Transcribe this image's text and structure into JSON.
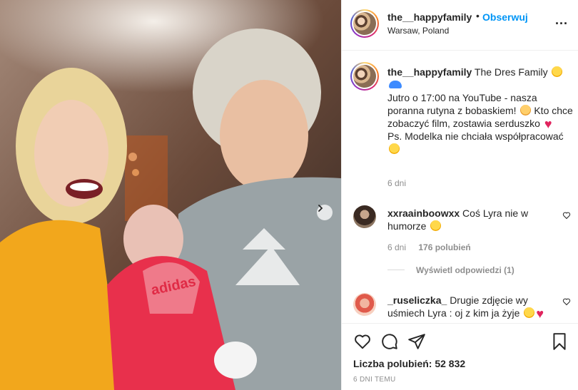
{
  "header": {
    "username": "the__happyfamily",
    "separator": "•",
    "follow_label": "Obserwuj",
    "location": "Warsaw, Poland",
    "more_label": "..."
  },
  "caption": {
    "username": "the__happyfamily",
    "line1": "The Dres Family",
    "line2": "Jutro o 17:00 na YouTube - nasza poranna rutyna z bobaskiem!",
    "line3": "Kto chce zobaczyć film, zostawia serduszko",
    "line4": "Ps. Modelka nie chciała współpracować",
    "time": "6 dni"
  },
  "comments": [
    {
      "username": "xxraainboowxx",
      "text": "Coś Lyra nie w humorze",
      "time": "6 dni",
      "likes": "176 polubień"
    },
    {
      "username": "_ruseliczka_",
      "text": "Drugie zdjęcie wy uśmiech Lyra : oj z kim ja żyje"
    }
  ],
  "view_replies": "Wyświetl odpowiedzi (1)",
  "likes_text": "Liczba polubień: 52 832",
  "date": "6 DNI TEMU",
  "icons": [
    "heart-icon",
    "comment-icon",
    "share-icon",
    "bookmark-icon",
    "chevron-right-icon"
  ],
  "colors": {
    "link": "#0095f6",
    "muted": "#8e8e8e",
    "text": "#262626"
  }
}
